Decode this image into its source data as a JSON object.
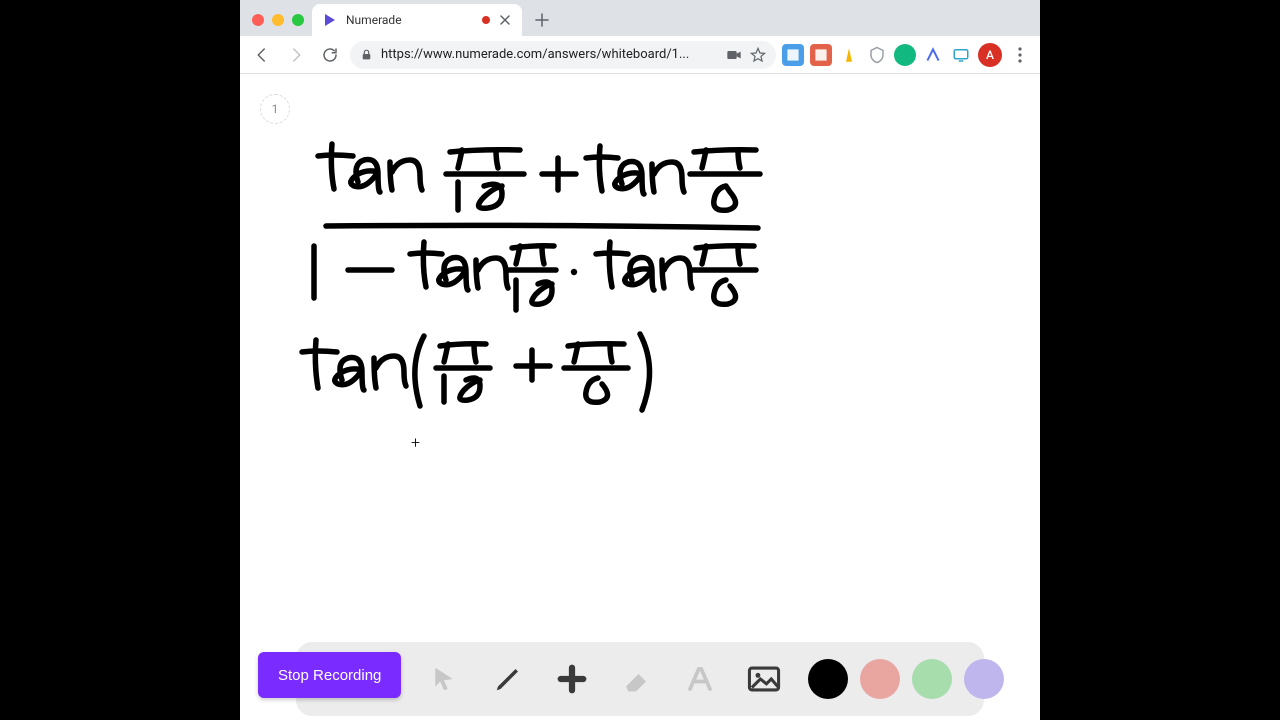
{
  "window": {
    "tab_title": "Numerade",
    "url_display": "https://www.numerade.com/answers/whiteboard/1..."
  },
  "page": {
    "page_number": "1"
  },
  "dock": {
    "stop_label": "Stop Recording",
    "colors": {
      "black": "#000000",
      "red": "#e9a6a1",
      "green": "#a7dcad",
      "purple": "#c0b6ee"
    }
  },
  "avatar": {
    "initial": "A"
  },
  "handwriting": {
    "line1": "tan π/18 + tan π/9",
    "line2": "1 − tan π/18 · tan π/9",
    "line3": "tan ( π/18 + π/9 )"
  }
}
